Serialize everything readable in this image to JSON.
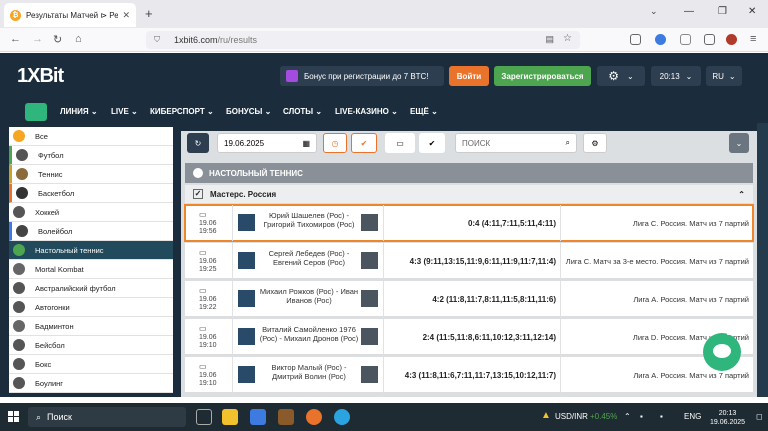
{
  "browser": {
    "tab_title": "Результаты Матчей ⊳ Результ...",
    "tab_favicon": "1xBit favicon",
    "url_host": "1xbit6.com",
    "url_path": "/ru/results"
  },
  "header": {
    "logo": "1XBit",
    "bonus_text": "Бонус при регистрации до 7 BTC!",
    "login_label": "Войти",
    "register_label": "Зарегистрироваться",
    "time": "20:13",
    "lang": "RU"
  },
  "menu": {
    "items": [
      "ЛИНИЯ",
      "LIVE",
      "КИБЕРСПОРТ",
      "БОНУСЫ",
      "СЛОТЫ",
      "LIVE-КАЗИНО",
      "ЕЩЁ"
    ]
  },
  "sidebar": {
    "items": [
      {
        "label": "Все",
        "color": "#f5a623"
      },
      {
        "label": "Футбол",
        "color": "#555555"
      },
      {
        "label": "Теннис",
        "color": "#8b6b3a"
      },
      {
        "label": "Баскетбол",
        "color": "#333333"
      },
      {
        "label": "Хоккей",
        "color": "#555555"
      },
      {
        "label": "Волейбол",
        "color": "#444444"
      },
      {
        "label": "Настольный теннис",
        "color": "#4ea54f"
      },
      {
        "label": "Mortal Kombat",
        "color": "#666666"
      },
      {
        "label": "Австралийский футбол",
        "color": "#555555"
      },
      {
        "label": "Автогонки",
        "color": "#555555"
      },
      {
        "label": "Бадминтон",
        "color": "#666666"
      },
      {
        "label": "Бейсбол",
        "color": "#555555"
      },
      {
        "label": "Бокс",
        "color": "#555555"
      },
      {
        "label": "Боулинг",
        "color": "#555555"
      }
    ]
  },
  "filters": {
    "date": "19.06.2025",
    "search_placeholder": "ПОИСК"
  },
  "section_title": "НАСТОЛЬНЫЙ ТЕННИС",
  "championship": "Мастерс. Россия",
  "matches": [
    {
      "date": "19.06",
      "time": "19:56",
      "names": "Юрий Шашелев (Рос) - Григорий Тихомиров (Рос)",
      "score": "0:4 (4:11,7:11,5:11,4:11)",
      "league": "Лига С. Россия. Матч из 7 партий"
    },
    {
      "date": "19.06",
      "time": "19:25",
      "names": "Сергей Лебедев (Рос) - Евгений Серов (Рос)",
      "score": "4:3 (9:11,13:15,11:9,6:11,11:9,11:7,11:4)",
      "league": "Лига С. Матч за 3-е место. Россия. Матч из 7 партий"
    },
    {
      "date": "19.06",
      "time": "19:22",
      "names": "Михаил Рожков (Рос) - Иван Иванов (Рос)",
      "score": "4:2 (11:8,11:7,8:11,11:5,8:11,11:6)",
      "league": "Лига А. Россия. Матч из 7 партий"
    },
    {
      "date": "19.06",
      "time": "19:10",
      "names": "Виталий Самойленко 1976 (Рос) - Михаил Дронов (Рос)",
      "score": "2:4 (11:5,11:8,6:11,10:12,3:11,12:14)",
      "league": "Лига D. Россия. Матч из 7 партий"
    },
    {
      "date": "19.06",
      "time": "19:10",
      "names": "Виктор Малый (Рос) - Дмитрий Волин (Рос)",
      "score": "4:3 (11:8,11:6,7:11,11:7,13:15,10:12,11:7)",
      "league": "Лига А. Россия. Матч из 7 партий"
    }
  ],
  "taskbar": {
    "search_label": "Поиск",
    "ticker": "USD/INR",
    "ticker_change": "+0.45%",
    "lang": "ENG",
    "time": "20:13",
    "date": "19.06.2025"
  }
}
